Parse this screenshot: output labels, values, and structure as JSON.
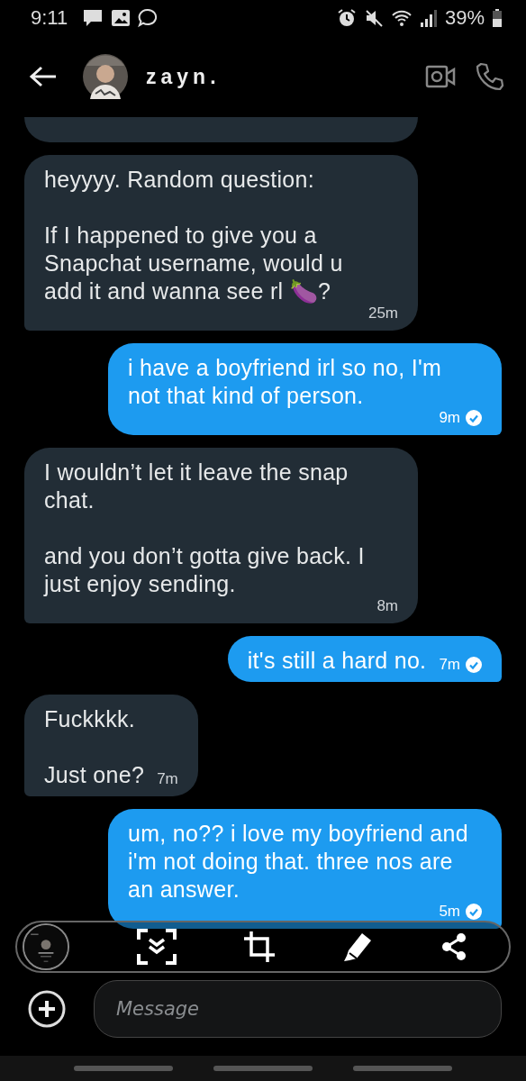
{
  "status_bar": {
    "time": "9:11",
    "battery": "39%"
  },
  "header": {
    "name": "zayn."
  },
  "messages": [
    {
      "kind": "received",
      "text": "heyyyy. Random question:\n\nIf I happened to give you a Snapchat username, would u add it and wanna see rl 🍆?",
      "time": "25m"
    },
    {
      "kind": "sent",
      "text": "i have a boyfriend irl so no, I'm not that kind of person.",
      "time": "9m",
      "read": true
    },
    {
      "kind": "received",
      "text": "I wouldn’t let it leave the snap chat.\n\nand you don’t gotta give back. I just enjoy sending.",
      "time": "8m"
    },
    {
      "kind": "sent",
      "text": "it's still a hard no.",
      "time": "7m",
      "read": true
    },
    {
      "kind": "received",
      "text": "Fuckkkk.\n\nJust one?",
      "time": "7m"
    },
    {
      "kind": "sent",
      "text": "um, no?? i love my boyfriend and i'm not doing that. three nos are an answer.",
      "time": "5m",
      "read": true
    }
  ],
  "composer": {
    "placeholder": "Message"
  }
}
